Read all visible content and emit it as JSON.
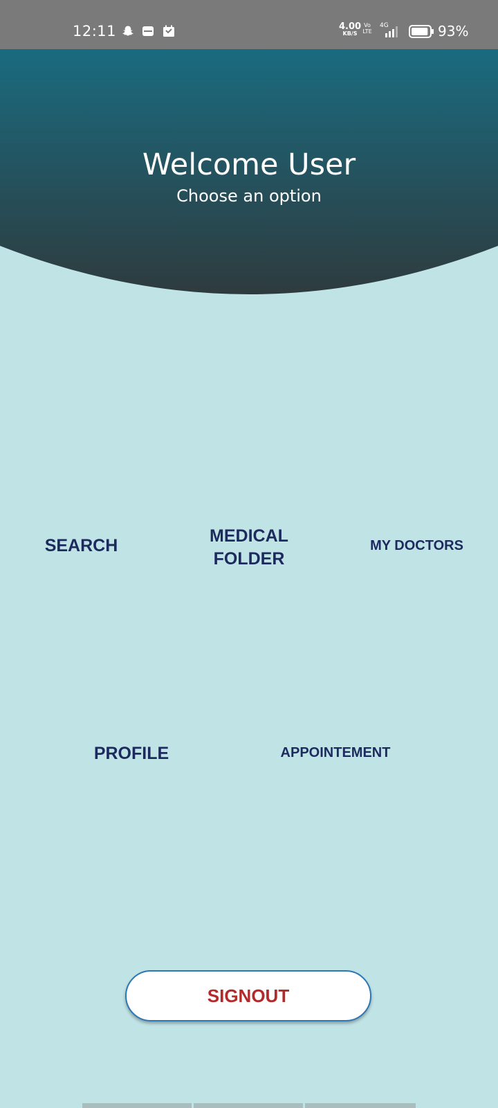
{
  "status_bar": {
    "time": "12:11",
    "net_speed_value": "4.00",
    "net_speed_unit": "KB/S",
    "volte_top": "Vo",
    "volte_bottom": "LTE",
    "network_type": "4G",
    "battery_level": 0.93,
    "battery_percent": "93%",
    "icons": [
      "snapchat-icon",
      "mail-icon",
      "calendar-icon",
      "signal-icon",
      "battery-icon"
    ]
  },
  "header": {
    "title": "Welcome User",
    "subtitle": "Choose an option",
    "gradient_top": "#1a6b80",
    "gradient_bottom": "#2e3b3e"
  },
  "options": {
    "search": "SEARCH",
    "medical_folder_line1": "MEDICAL",
    "medical_folder_line2": "FOLDER",
    "my_doctors": "MY DOCTORS",
    "profile": "PROFILE",
    "appointment": "APPOINTEMENT"
  },
  "signout": {
    "label": "SIGNOUT"
  },
  "colors": {
    "background": "#c0e3e6",
    "option_text": "#1c2a5e",
    "signout_text": "#b22a2a",
    "signout_border": "#2a78b5"
  }
}
